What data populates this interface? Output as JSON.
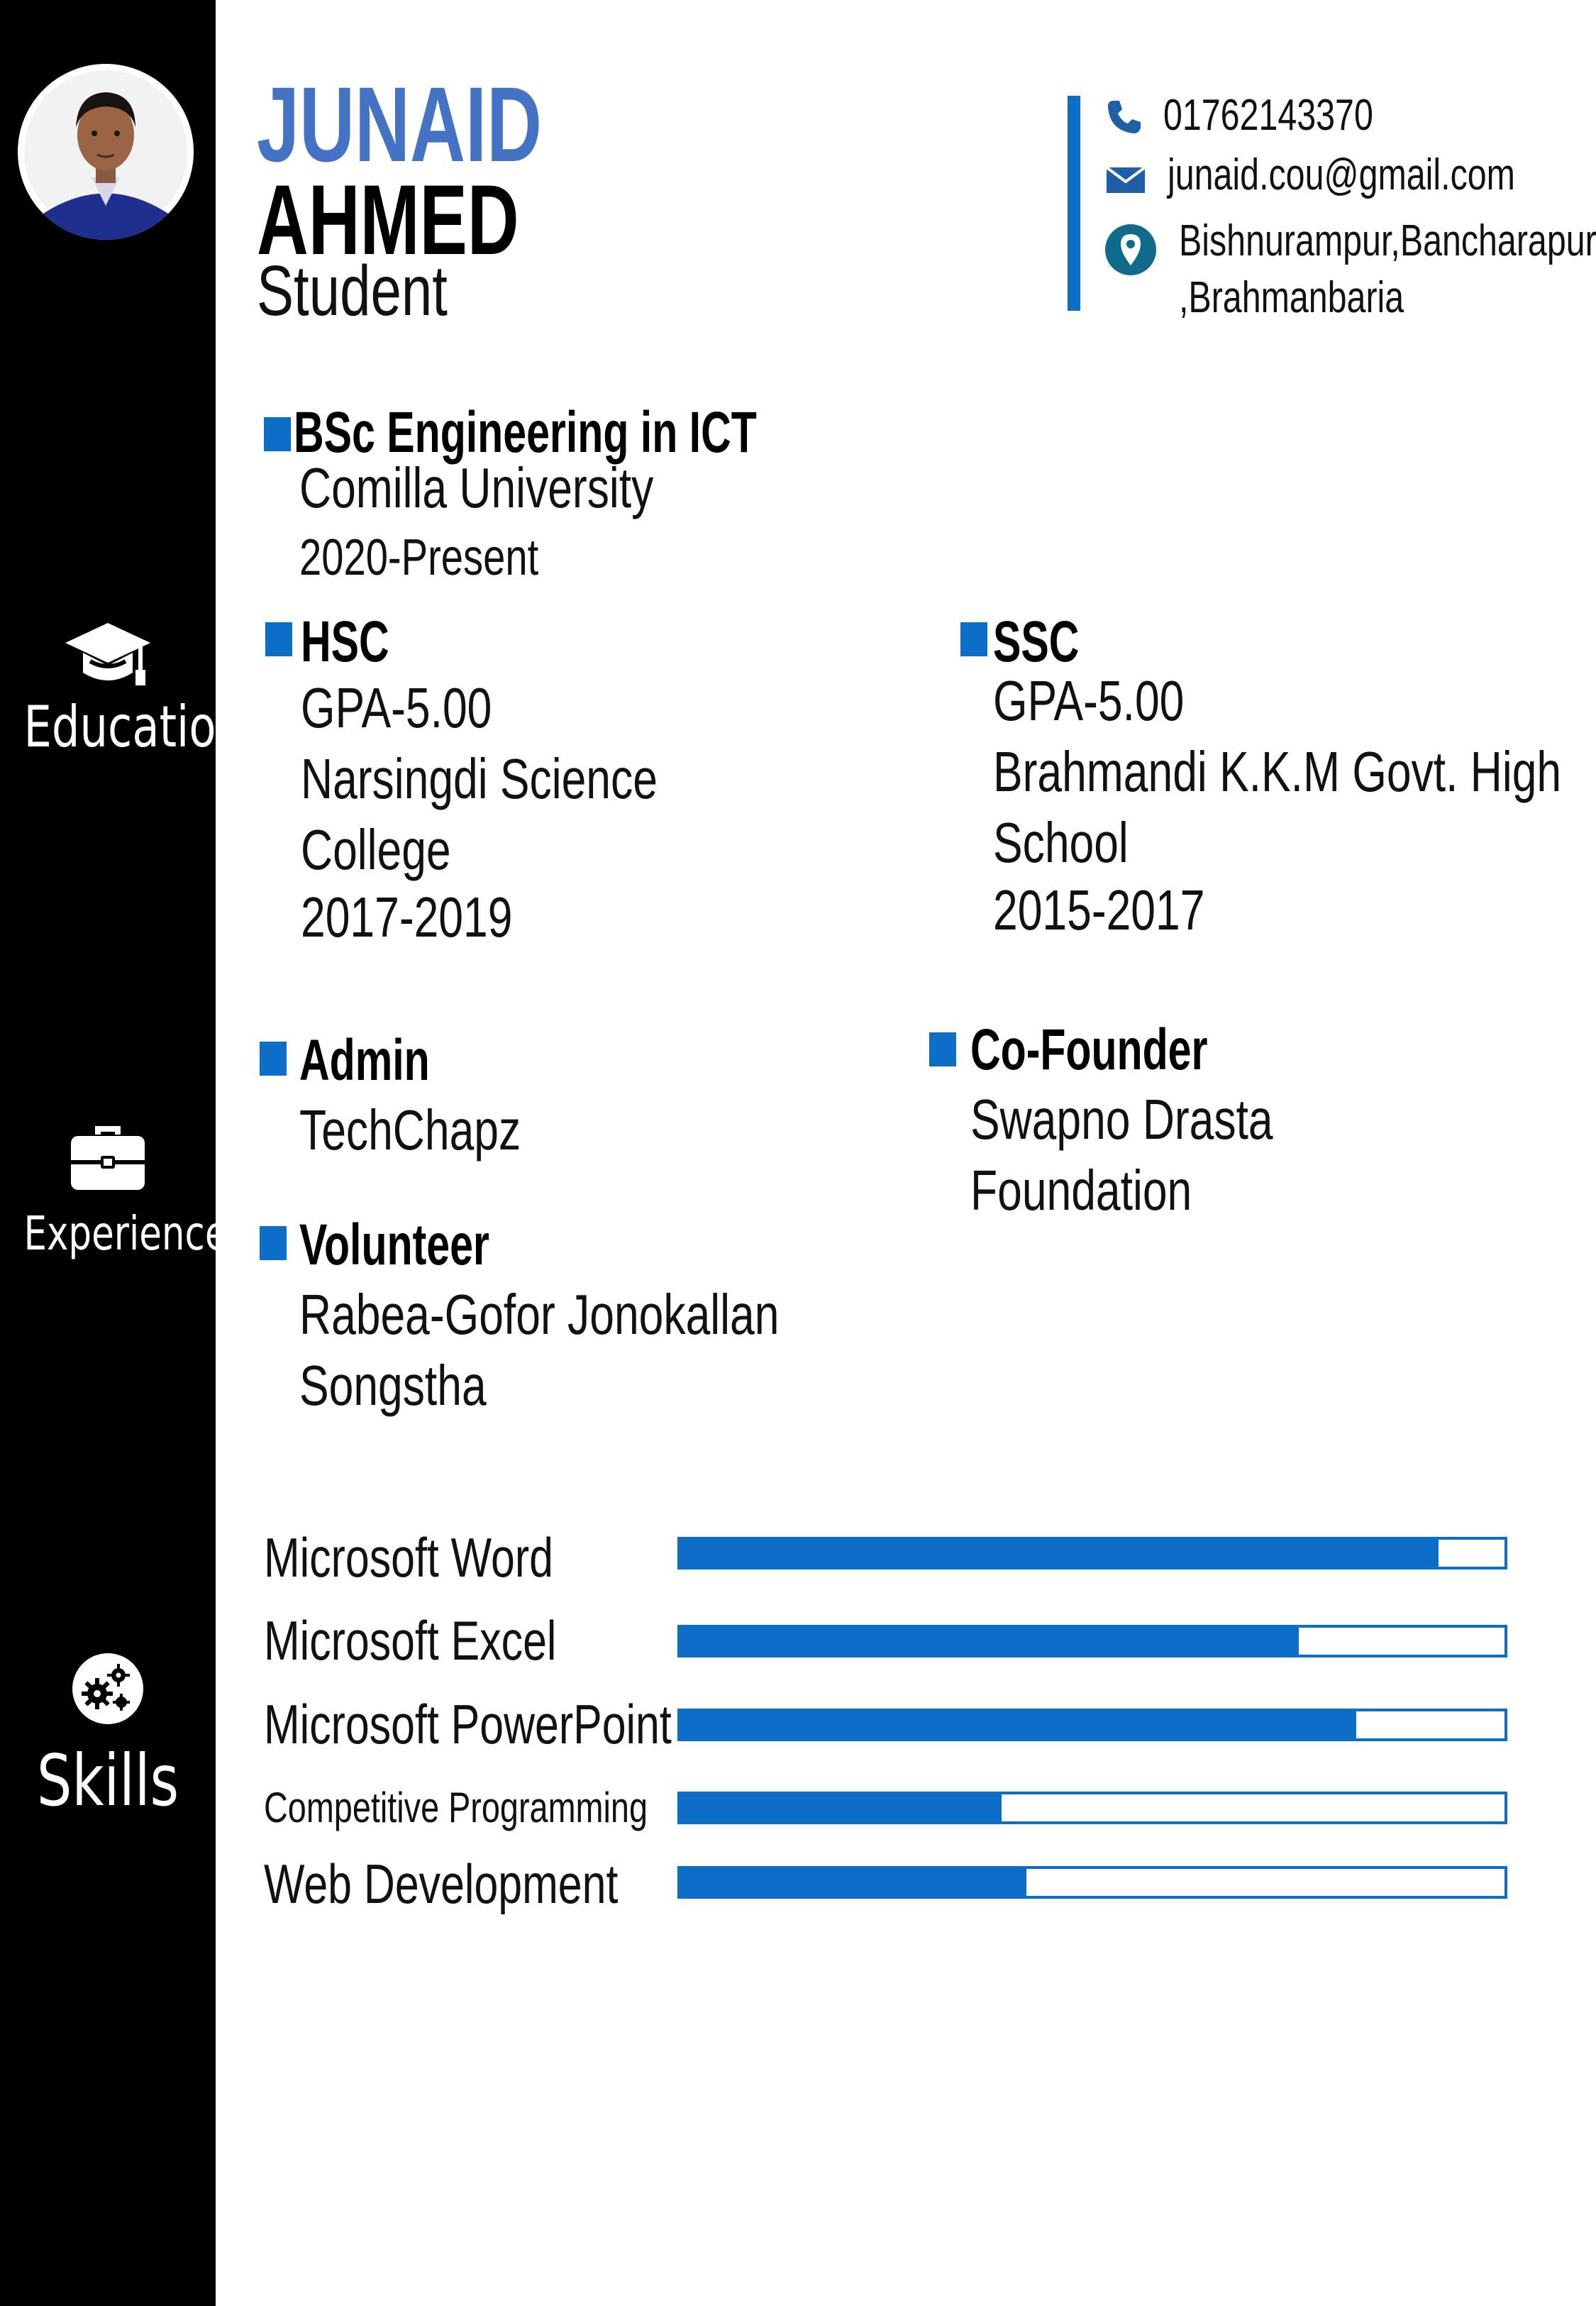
{
  "colors": {
    "accent": "#0d6ec8",
    "name_blue": "#4472c4",
    "sidebar": "#000000"
  },
  "header": {
    "first_name": "JUNAID",
    "last_name": "AHMED",
    "role": "Student"
  },
  "contact": {
    "phone": "01762143370",
    "email": "junaid.cou@gmail.com",
    "address_line1": "Bishnurampur,Bancharapur",
    "address_line2": ",Brahmanbaria",
    "icons": [
      "phone-icon",
      "mail-icon",
      "location-pin-icon"
    ]
  },
  "sidebar": {
    "education_label": "Education",
    "experiences_label": "Experiences",
    "skills_label": "Skills",
    "icons": [
      "graduation-cap-icon",
      "briefcase-icon",
      "gears-icon"
    ]
  },
  "education": {
    "degree": {
      "title": "BSc Engineering in ICT",
      "institution": "Comilla University",
      "years": "2020-Present"
    },
    "hsc": {
      "title": "HSC",
      "gpa": "GPA-5.00",
      "institution_line1": "Narsingdi Science",
      "institution_line2": "College",
      "years": "2017-2019"
    },
    "ssc": {
      "title": "SSC",
      "gpa": "GPA-5.00",
      "institution_line1": "Brahmandi K.K.M Govt. High",
      "institution_line2": "School",
      "years": "2015-2017"
    }
  },
  "experiences": {
    "admin": {
      "title": "Admin",
      "org": "TechChapz"
    },
    "cofounder": {
      "title": "Co-Founder",
      "org_line1": "Swapno Drasta",
      "org_line2": "Foundation"
    },
    "volunteer": {
      "title": "Volunteer",
      "org_line1": "Rabea-Gofor Jonokallan",
      "org_line2": "Songstha"
    }
  },
  "skills": [
    {
      "name": "Microsoft Word",
      "level": 0.92
    },
    {
      "name": "Microsoft Excel",
      "level": 0.75
    },
    {
      "name": "Microsoft PowerPoint",
      "level": 0.82
    },
    {
      "name": "Competitive Programming",
      "level": 0.39
    },
    {
      "name": "Web Development",
      "level": 0.42
    }
  ]
}
